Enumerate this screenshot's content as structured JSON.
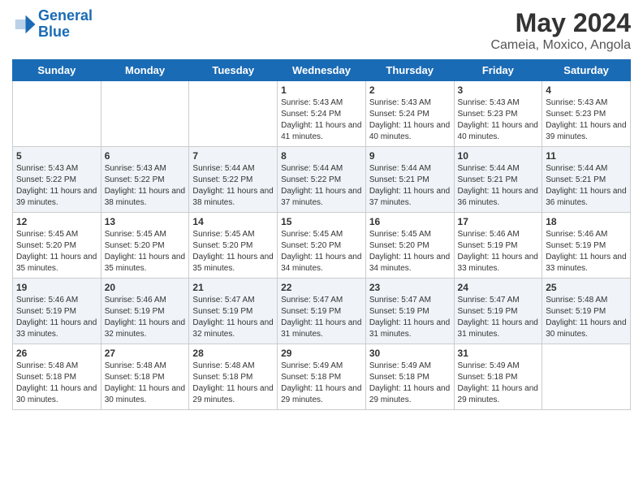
{
  "logo": {
    "line1": "General",
    "line2": "Blue"
  },
  "title": "May 2024",
  "subtitle": "Cameia, Moxico, Angola",
  "weekdays": [
    "Sunday",
    "Monday",
    "Tuesday",
    "Wednesday",
    "Thursday",
    "Friday",
    "Saturday"
  ],
  "weeks": [
    [
      {
        "day": "",
        "info": ""
      },
      {
        "day": "",
        "info": ""
      },
      {
        "day": "",
        "info": ""
      },
      {
        "day": "1",
        "info": "Sunrise: 5:43 AM\nSunset: 5:24 PM\nDaylight: 11 hours and 41 minutes."
      },
      {
        "day": "2",
        "info": "Sunrise: 5:43 AM\nSunset: 5:24 PM\nDaylight: 11 hours and 40 minutes."
      },
      {
        "day": "3",
        "info": "Sunrise: 5:43 AM\nSunset: 5:23 PM\nDaylight: 11 hours and 40 minutes."
      },
      {
        "day": "4",
        "info": "Sunrise: 5:43 AM\nSunset: 5:23 PM\nDaylight: 11 hours and 39 minutes."
      }
    ],
    [
      {
        "day": "5",
        "info": "Sunrise: 5:43 AM\nSunset: 5:22 PM\nDaylight: 11 hours and 39 minutes."
      },
      {
        "day": "6",
        "info": "Sunrise: 5:43 AM\nSunset: 5:22 PM\nDaylight: 11 hours and 38 minutes."
      },
      {
        "day": "7",
        "info": "Sunrise: 5:44 AM\nSunset: 5:22 PM\nDaylight: 11 hours and 38 minutes."
      },
      {
        "day": "8",
        "info": "Sunrise: 5:44 AM\nSunset: 5:22 PM\nDaylight: 11 hours and 37 minutes."
      },
      {
        "day": "9",
        "info": "Sunrise: 5:44 AM\nSunset: 5:21 PM\nDaylight: 11 hours and 37 minutes."
      },
      {
        "day": "10",
        "info": "Sunrise: 5:44 AM\nSunset: 5:21 PM\nDaylight: 11 hours and 36 minutes."
      },
      {
        "day": "11",
        "info": "Sunrise: 5:44 AM\nSunset: 5:21 PM\nDaylight: 11 hours and 36 minutes."
      }
    ],
    [
      {
        "day": "12",
        "info": "Sunrise: 5:45 AM\nSunset: 5:20 PM\nDaylight: 11 hours and 35 minutes."
      },
      {
        "day": "13",
        "info": "Sunrise: 5:45 AM\nSunset: 5:20 PM\nDaylight: 11 hours and 35 minutes."
      },
      {
        "day": "14",
        "info": "Sunrise: 5:45 AM\nSunset: 5:20 PM\nDaylight: 11 hours and 35 minutes."
      },
      {
        "day": "15",
        "info": "Sunrise: 5:45 AM\nSunset: 5:20 PM\nDaylight: 11 hours and 34 minutes."
      },
      {
        "day": "16",
        "info": "Sunrise: 5:45 AM\nSunset: 5:20 PM\nDaylight: 11 hours and 34 minutes."
      },
      {
        "day": "17",
        "info": "Sunrise: 5:46 AM\nSunset: 5:19 PM\nDaylight: 11 hours and 33 minutes."
      },
      {
        "day": "18",
        "info": "Sunrise: 5:46 AM\nSunset: 5:19 PM\nDaylight: 11 hours and 33 minutes."
      }
    ],
    [
      {
        "day": "19",
        "info": "Sunrise: 5:46 AM\nSunset: 5:19 PM\nDaylight: 11 hours and 33 minutes."
      },
      {
        "day": "20",
        "info": "Sunrise: 5:46 AM\nSunset: 5:19 PM\nDaylight: 11 hours and 32 minutes."
      },
      {
        "day": "21",
        "info": "Sunrise: 5:47 AM\nSunset: 5:19 PM\nDaylight: 11 hours and 32 minutes."
      },
      {
        "day": "22",
        "info": "Sunrise: 5:47 AM\nSunset: 5:19 PM\nDaylight: 11 hours and 31 minutes."
      },
      {
        "day": "23",
        "info": "Sunrise: 5:47 AM\nSunset: 5:19 PM\nDaylight: 11 hours and 31 minutes."
      },
      {
        "day": "24",
        "info": "Sunrise: 5:47 AM\nSunset: 5:19 PM\nDaylight: 11 hours and 31 minutes."
      },
      {
        "day": "25",
        "info": "Sunrise: 5:48 AM\nSunset: 5:19 PM\nDaylight: 11 hours and 30 minutes."
      }
    ],
    [
      {
        "day": "26",
        "info": "Sunrise: 5:48 AM\nSunset: 5:18 PM\nDaylight: 11 hours and 30 minutes."
      },
      {
        "day": "27",
        "info": "Sunrise: 5:48 AM\nSunset: 5:18 PM\nDaylight: 11 hours and 30 minutes."
      },
      {
        "day": "28",
        "info": "Sunrise: 5:48 AM\nSunset: 5:18 PM\nDaylight: 11 hours and 29 minutes."
      },
      {
        "day": "29",
        "info": "Sunrise: 5:49 AM\nSunset: 5:18 PM\nDaylight: 11 hours and 29 minutes."
      },
      {
        "day": "30",
        "info": "Sunrise: 5:49 AM\nSunset: 5:18 PM\nDaylight: 11 hours and 29 minutes."
      },
      {
        "day": "31",
        "info": "Sunrise: 5:49 AM\nSunset: 5:18 PM\nDaylight: 11 hours and 29 minutes."
      },
      {
        "day": "",
        "info": ""
      }
    ]
  ]
}
